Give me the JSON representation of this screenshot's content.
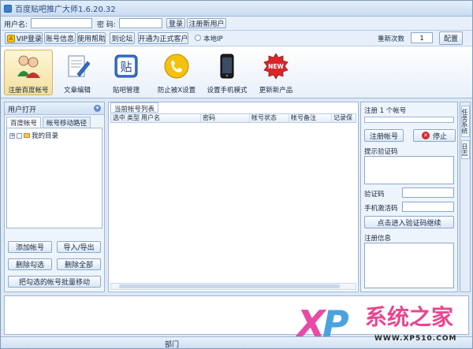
{
  "window": {
    "title": "百度贴吧推广大师1.6.20.32"
  },
  "login": {
    "username_label": "用户名:",
    "username_value": "",
    "password_label": "密  码:",
    "password_value": "",
    "login_button": "登录",
    "register_button": "注册新用户"
  },
  "toolbar": {
    "vip_button": "VIP登录",
    "accounts_button": "账号信息",
    "help_button": "使用帮助",
    "forum_button": "到论坛",
    "upgrade_button": "开通为正式客户",
    "local_ip_label": "本地IP",
    "retry_label": "重新次数",
    "retry_value": "1",
    "config_button": "配置"
  },
  "ribbon": {
    "items": [
      {
        "label": "注册百度帐号",
        "icon": "person-icon",
        "active": true
      },
      {
        "label": "文章编辑",
        "icon": "document-edit-icon",
        "active": false
      },
      {
        "label": "贴吧管理",
        "icon": "post-icon",
        "active": false
      },
      {
        "label": "防止被X设置",
        "icon": "phone-handset-icon",
        "active": false
      },
      {
        "label": "设置手机模式",
        "icon": "mobile-phone-icon",
        "active": false
      },
      {
        "label": "更新新产品",
        "icon": "new-badge-icon",
        "active": false
      }
    ]
  },
  "left_panel": {
    "header": "用户打开",
    "tabs": [
      "百度帐号",
      "帐号移动路径"
    ],
    "tree_item": "我的目录",
    "buttons": {
      "add_account": "添加帐号",
      "import_export": "导入/导出",
      "delete_selected": "删除勾选",
      "delete_all": "删除全部",
      "batch_move": "把勾选的帐号批量移动"
    }
  },
  "center_panel": {
    "tab": "当前帐号列表",
    "columns": [
      "选中",
      "类型",
      "用户名",
      "密码",
      "帐号状态",
      "帐号备注",
      "记录保"
    ]
  },
  "right_panel": {
    "status": "注册 1 个帐号",
    "register_button": "注册帐号",
    "stop_button": "停止",
    "captcha_prompt": "提示验证码",
    "captcha_label": "验证码",
    "mobile_code_label": "手机激活码",
    "enter_captcha_button": "点击进入验证码继续",
    "result_label": "注册信息"
  },
  "side_tabs": [
    "任务系统",
    "日志"
  ],
  "statusbar": {
    "text": "部门"
  },
  "watermark": {
    "brand": "系统之家",
    "url": "WWW.XP510.COM"
  }
}
